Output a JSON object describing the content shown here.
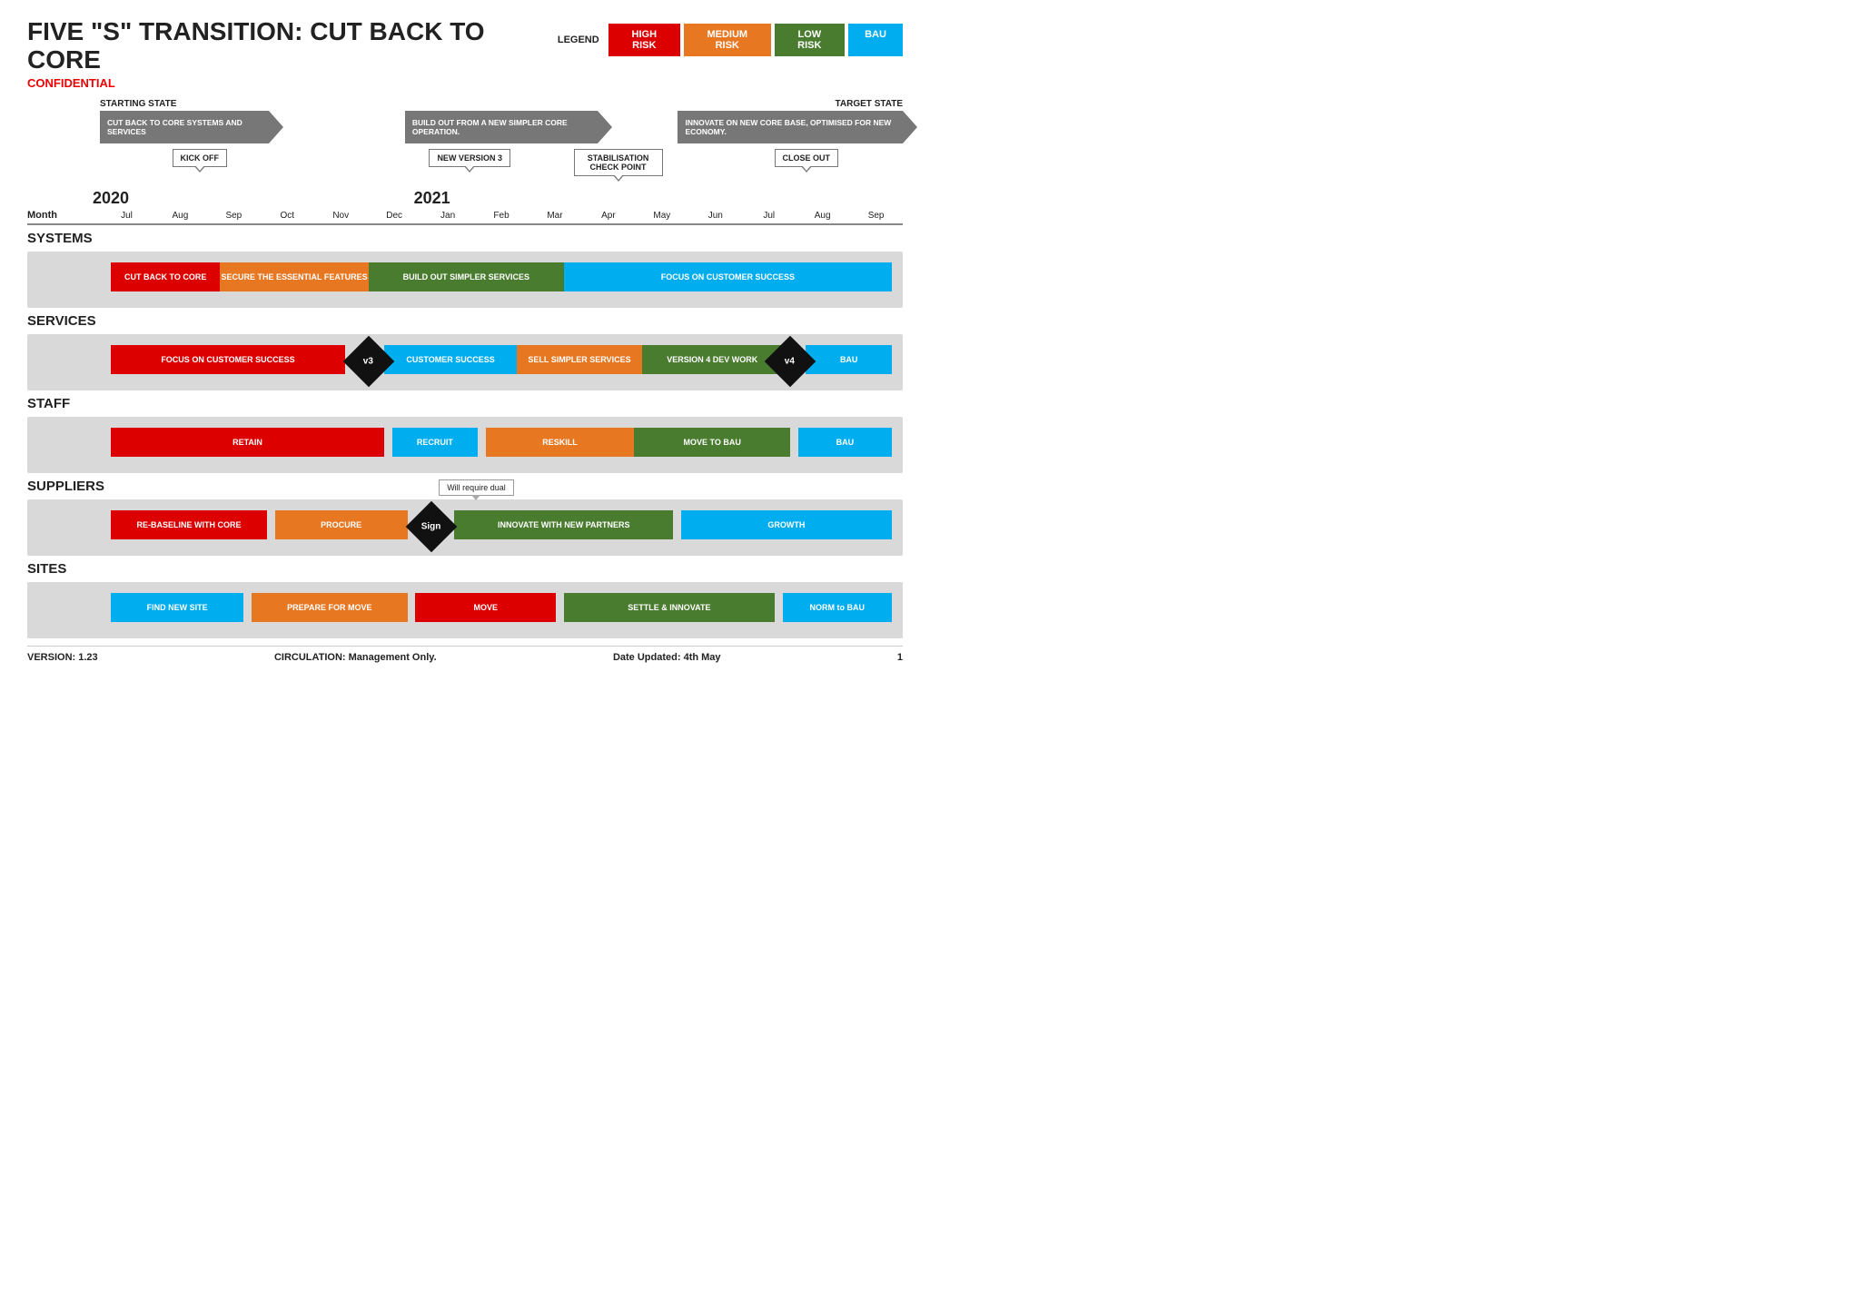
{
  "header": {
    "title": "FIVE \"S\" TRANSITION: CUT BACK TO CORE",
    "confidential": "CONFIDENTIAL",
    "legend_label": "LEGEND",
    "legend_items": [
      {
        "label": "HIGH RISK",
        "color": "#dd0000"
      },
      {
        "label": "MEDIUM RISK",
        "color": "#e87722"
      },
      {
        "label": "LOW RISK",
        "color": "#4a7c2f"
      },
      {
        "label": "BAU",
        "color": "#00adef"
      }
    ]
  },
  "timeline": {
    "starting_state": "STARTING STATE",
    "target_state": "TARGET STATE",
    "month_label": "Month",
    "year_2020": "2020",
    "year_2021": "2021",
    "months": [
      "Jul",
      "Aug",
      "Sep",
      "Oct",
      "Nov",
      "Dec",
      "Jan",
      "Feb",
      "Mar",
      "Apr",
      "May",
      "Jun",
      "Jul",
      "Aug",
      "Sep"
    ],
    "callout_1": "CUT BACK TO CORE SYSTEMS AND SERVICES",
    "callout_2": "BUILD OUT FROM A NEW SIMPLER CORE OPERATION.",
    "callout_3": "INNOVATE ON NEW CORE BASE, OPTIMISED FOR NEW ECONOMY.",
    "bubble_kick_off": "KICK OFF",
    "bubble_new_v3": "NEW VERSION 3",
    "bubble_stab": "STABILISATION CHECK POINT",
    "bubble_close": "CLOSE OUT"
  },
  "sections": {
    "systems": {
      "title": "SYSTEMS",
      "bars": [
        {
          "label": "CUT BACK TO CORE",
          "color": "red",
          "start": 0,
          "end": 14
        },
        {
          "label": "SECURE THE ESSENTIAL FEATURES",
          "color": "orange",
          "start": 14,
          "end": 33
        },
        {
          "label": "BUILD OUT SIMPLER SERVICES",
          "color": "green",
          "start": 33,
          "end": 58
        },
        {
          "label": "FOCUS ON CUSTOMER SUCCESS",
          "color": "blue",
          "start": 58,
          "end": 100
        }
      ]
    },
    "services": {
      "title": "SERVICES",
      "bars": [
        {
          "label": "FOCUS ON CUSTOMER SUCCESS",
          "color": "red",
          "start": 0,
          "end": 30
        },
        {
          "label": "v3",
          "type": "diamond",
          "pos": 33
        },
        {
          "label": "CUSTOMER SUCCESS",
          "color": "blue",
          "start": 35,
          "end": 52
        },
        {
          "label": "SELL SIMPLER SERVICES",
          "color": "orange",
          "start": 52,
          "end": 68
        },
        {
          "label": "VERSION 4 DEV WORK",
          "color": "green",
          "start": 68,
          "end": 86
        },
        {
          "label": "v4",
          "type": "diamond",
          "pos": 87
        },
        {
          "label": "BAU",
          "color": "blue",
          "start": 89,
          "end": 100
        }
      ]
    },
    "staff": {
      "title": "STAFF",
      "bars": [
        {
          "label": "RETAIN",
          "color": "red",
          "start": 0,
          "end": 35
        },
        {
          "label": "RECRUIT",
          "color": "blue",
          "start": 36,
          "end": 47
        },
        {
          "label": "RESKILL",
          "color": "orange",
          "start": 48,
          "end": 67
        },
        {
          "label": "MOVE TO BAU",
          "color": "green",
          "start": 67,
          "end": 87
        },
        {
          "label": "BAU",
          "color": "blue",
          "start": 88,
          "end": 100
        }
      ]
    },
    "suppliers": {
      "title": "SUPPLIERS",
      "bars": [
        {
          "label": "RE-BASELINE WITH CORE",
          "color": "red",
          "start": 0,
          "end": 20
        },
        {
          "label": "PROCURE",
          "color": "orange",
          "start": 21,
          "end": 38
        },
        {
          "label": "Sign",
          "type": "diamond",
          "pos": 41
        },
        {
          "label": "INNOVATE WITH NEW PARTNERS",
          "color": "green",
          "start": 44,
          "end": 72
        },
        {
          "label": "GROWTH",
          "color": "blue",
          "start": 73,
          "end": 100
        }
      ],
      "tooltip": "Will require dual"
    },
    "sites": {
      "title": "SITES",
      "bars": [
        {
          "label": "FIND NEW SITE",
          "color": "blue",
          "start": 0,
          "end": 17
        },
        {
          "label": "PREPARE FOR MOVE",
          "color": "orange",
          "start": 18,
          "end": 38
        },
        {
          "label": "MOVE",
          "color": "red",
          "start": 39,
          "end": 57
        },
        {
          "label": "SETTLE & INNOVATE",
          "color": "green",
          "start": 58,
          "end": 85
        },
        {
          "label": "NORM to BAU",
          "color": "blue",
          "start": 86,
          "end": 100
        }
      ]
    }
  },
  "footer": {
    "version": "VERSION: 1.23",
    "circulation": "CIRCULATION: Management Only.",
    "date": "Date Updated: 4th May",
    "page": "1"
  }
}
